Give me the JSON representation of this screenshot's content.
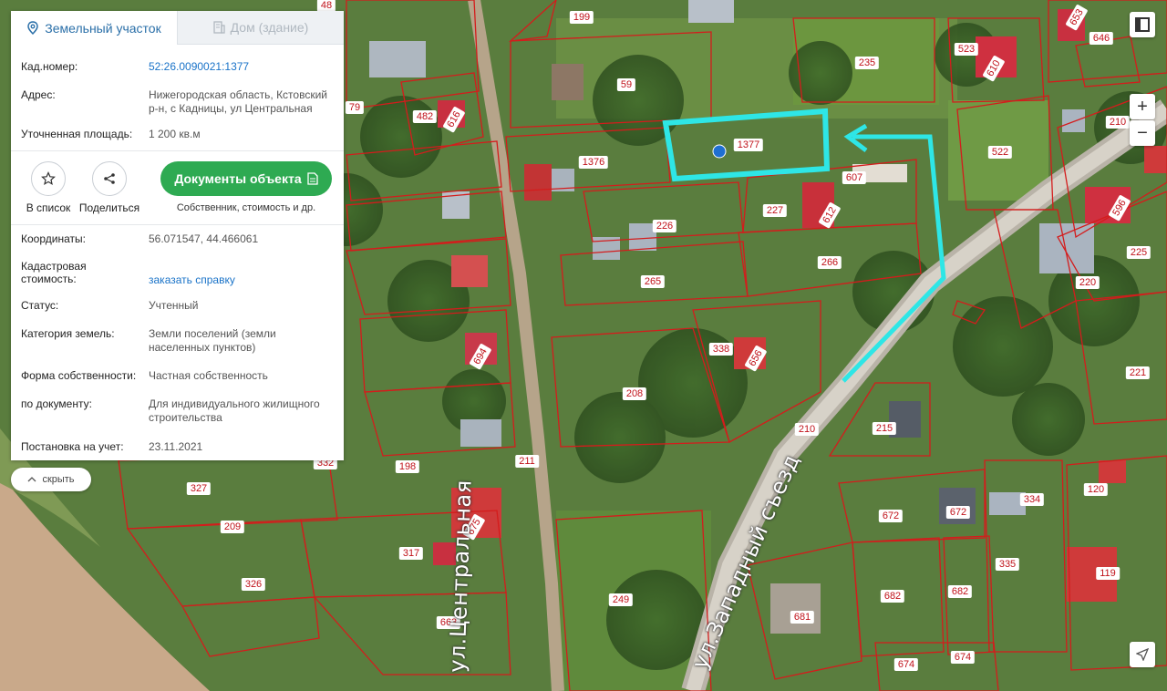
{
  "panel": {
    "tabs": [
      {
        "label": "Земельный участок",
        "icon": "map-pin-icon",
        "active": true
      },
      {
        "label": "Дом (здание)",
        "icon": "building-icon",
        "active": false
      }
    ],
    "cad_number": {
      "label": "Кад.номер:",
      "value": "52:26.0090021:1377"
    },
    "address": {
      "label": "Адрес:",
      "line1": "Нижегородская область, Кстовский",
      "line2": "р-н, с Кадницы, ул Центральная"
    },
    "area": {
      "label": "Уточненная площадь:",
      "value": "1 200 кв.м"
    },
    "actions": {
      "add_to_list": "В список",
      "share": "Поделиться",
      "documents_button": "Документы объекта",
      "documents_sub": "Собственник, стоимость и др."
    },
    "coords": {
      "label": "Координаты:",
      "value": "56.071547, 44.466061"
    },
    "cost": {
      "label1": "Кадастровая",
      "label2": "стоимость:",
      "value": "заказать справку"
    },
    "status": {
      "label": "Статус:",
      "value": "Учтенный"
    },
    "category": {
      "label": "Категория земель:",
      "line1": "Земли поселений (земли",
      "line2": "населенных пунктов)"
    },
    "ownership": {
      "label": "Форма собственности:",
      "value": "Частная собственность"
    },
    "by_document": {
      "label": "по документу:",
      "line1": "Для индивидуального жилищного",
      "line2": "строительства"
    },
    "registered": {
      "label": "Постановка на учет:",
      "value": "23.11.2021"
    }
  },
  "hide_button": "скрыть",
  "map": {
    "zoom_in": "+",
    "zoom_out": "−",
    "streets": [
      "ул.Центральная",
      "ул.Западный съезд"
    ],
    "parcel_numbers": [
      "48",
      "199",
      "59",
      "235",
      "523",
      "610",
      "653",
      "646",
      "79",
      "482",
      "616",
      "1376",
      "1377",
      "607",
      "227",
      "612",
      "522",
      "210",
      "596",
      "226",
      "265",
      "266",
      "225",
      "220",
      "694",
      "338",
      "656",
      "208",
      "221",
      "210",
      "215",
      "332",
      "198",
      "211",
      "327",
      "209",
      "317",
      "675",
      "326",
      "663",
      "249",
      "672",
      "672",
      "334",
      "120",
      "681",
      "682",
      "682",
      "335",
      "119",
      "674",
      "674"
    ],
    "colors": {
      "parcel_border": "#d41c1c",
      "highlight": "#2ee6e6",
      "marker": "#1f6fd1",
      "doc_button": "#2eaa52",
      "link": "#1a73c8"
    }
  }
}
